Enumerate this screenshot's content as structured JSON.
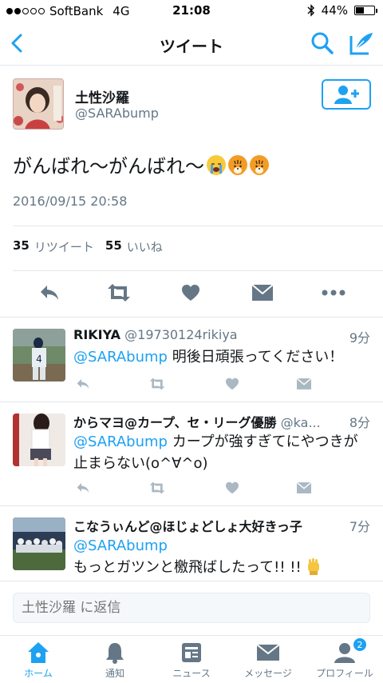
{
  "status_bar": {
    "carrier": "SoftBank",
    "network": "4G",
    "time": "21:08",
    "battery": "44%",
    "battery_level": 0.44,
    "signal_bars": 2
  },
  "nav": {
    "title": "ツイート",
    "icons": [
      "back-chevron-icon",
      "search-icon",
      "compose-icon"
    ]
  },
  "tweet": {
    "author_name": "土性沙羅",
    "author_handle": "@SARAbump",
    "text": "がんばれ〜がんばれ〜",
    "emojis": [
      "loudly-crying-face",
      "tiger-face",
      "tiger-face"
    ],
    "timestamp": "2016/09/15 20:58",
    "retweet_count": "35",
    "retweet_label": "リツイート",
    "like_count": "55",
    "like_label": "いいね",
    "actions": [
      "reply-icon",
      "retweet-icon",
      "like-heart-icon",
      "direct-message-icon",
      "more-dots-icon"
    ]
  },
  "replies": [
    {
      "name": "RIKIYA",
      "handle": "@19730124rikiya",
      "time": "9分",
      "mention": "@SARAbump",
      "text": " 明後日頑張ってください！"
    },
    {
      "name": "からマヨ@カープ、セ・リーグ優勝",
      "handle": "@ka...",
      "time": "8分",
      "mention": "@SARAbump",
      "text": " カープが強すぎてにやつきが止まらない(o^∀^o)"
    },
    {
      "name": "こなうぃんど@ほじょどしょ大好きっ子",
      "handle": "",
      "time": "7分",
      "mention": "@SARAbump",
      "text": "もっとガツンと檄飛ばしたって!! !!"
    }
  ],
  "reply_bar": {
    "placeholder": "土性沙羅 に返信"
  },
  "tab_bar": {
    "tabs": [
      {
        "label": "ホーム",
        "icon": "home-icon",
        "active": true
      },
      {
        "label": "通知",
        "icon": "bell-icon",
        "active": false
      },
      {
        "label": "ニュース",
        "icon": "news-icon",
        "active": false
      },
      {
        "label": "メッセージ",
        "icon": "envelope-icon",
        "active": false
      },
      {
        "label": "プロフィール",
        "icon": "profile-icon",
        "active": false,
        "badge": "2"
      }
    ]
  },
  "colors": {
    "accent": "#1da1f2",
    "secondary_text": "#657786",
    "action_gray": "#657786",
    "divider": "#e1e8ed"
  }
}
